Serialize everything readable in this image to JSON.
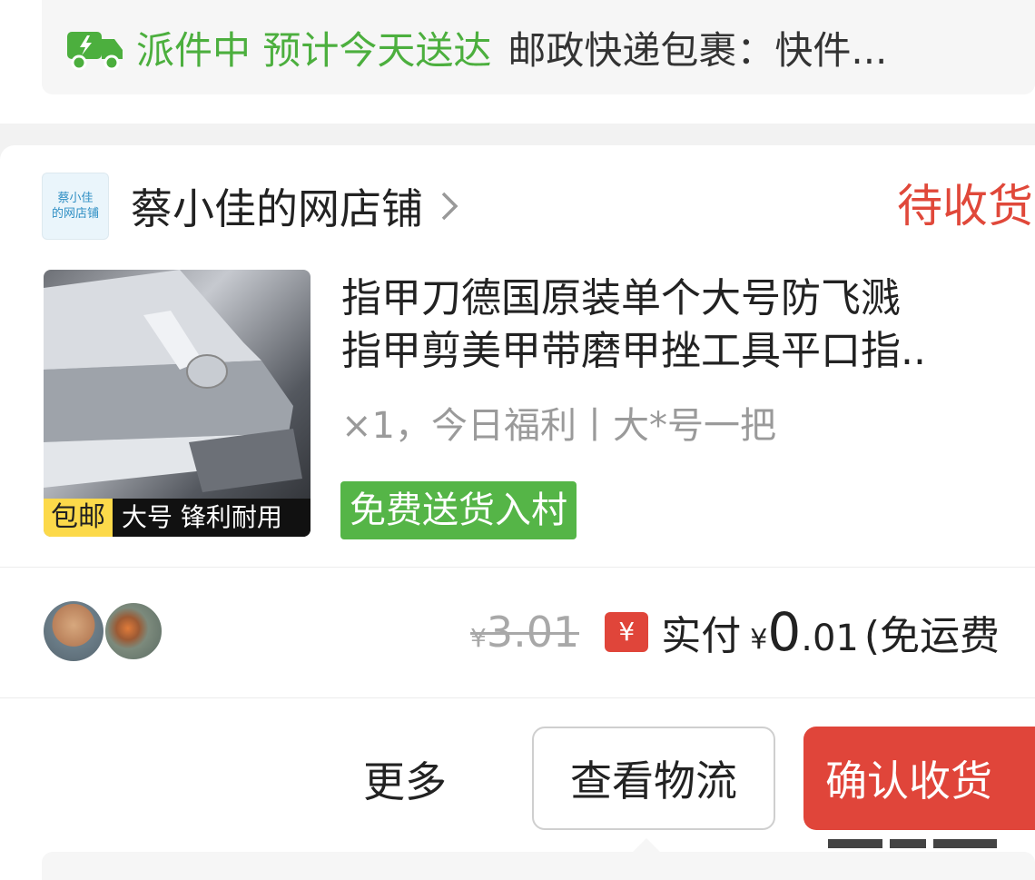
{
  "delivery": {
    "status": "派件中 预计今天送达",
    "detail": "邮政快递包裹：快件...",
    "icon": "delivery-truck-icon",
    "status_color": "#4caf3e"
  },
  "shop": {
    "logo_line1": "蔡小佳",
    "logo_line2": "的网店铺",
    "name": "蔡小佳的网店铺",
    "chevron_icon": "chevron-right-icon",
    "order_status": "待收货",
    "status_color": "#e0483a"
  },
  "product": {
    "badge_free": "包邮",
    "badge_desc": "大号 锋利耐用",
    "title_line1": "指甲刀德国原装单个大号防飞溅",
    "title_line2": "指甲剪美甲带磨甲挫工具平口指..",
    "spec": "×1，今日福利丨大*号一把",
    "village_badge": "免费送货入村"
  },
  "price": {
    "original_yen": "¥",
    "original": "3.01",
    "pay_icon": "¥",
    "paid_label": "实付",
    "paid_yen": "¥",
    "paid_int": "0",
    "paid_dec": ".01",
    "paid_note": "(免运费"
  },
  "actions": {
    "more": "更多",
    "logistics": "查看物流",
    "confirm": "确认收货",
    "accent": "#e0453a"
  }
}
